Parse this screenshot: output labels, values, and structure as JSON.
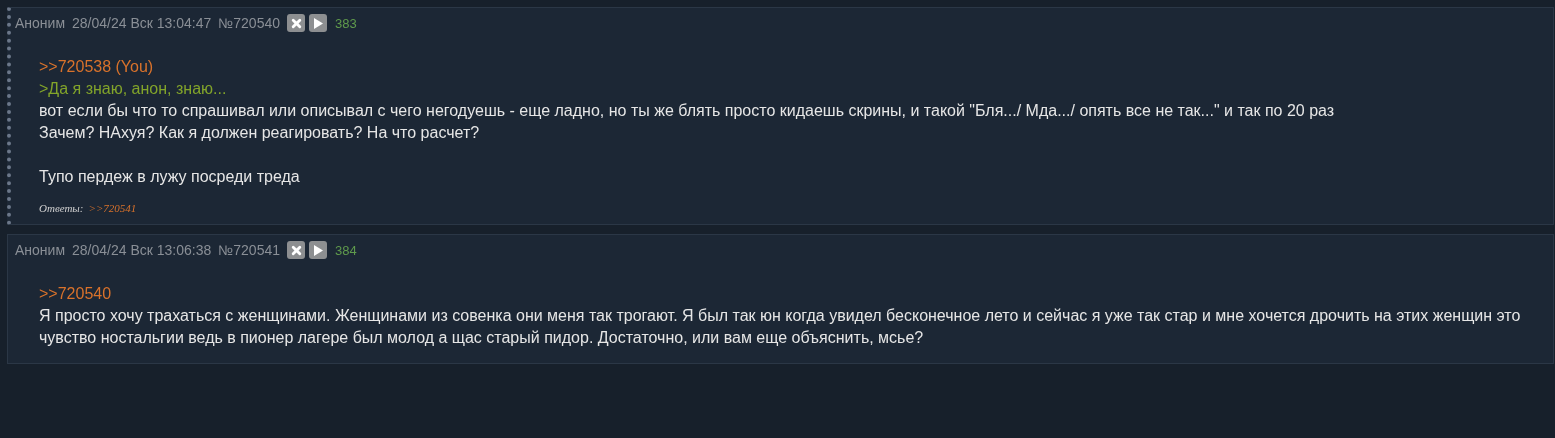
{
  "posts": [
    {
      "highlighted": true,
      "name": "Аноним",
      "date": "28/04/24 Вск 13:04:47",
      "number": "№720540",
      "count": "383",
      "lines": [
        {
          "kind": "reply_link",
          "text": ">>720538 (You)"
        },
        {
          "kind": "quote",
          "text": ">Да я знаю, анон, знаю..."
        },
        {
          "kind": "text",
          "text": "вот если бы что то спрашивал или описывал с чего негодуешь - еще ладно, но ты же блять просто кидаешь скрины, и такой \"Бля.../ Мда.../ опять все не так...\" и так по 20 раз"
        },
        {
          "kind": "text",
          "text": "Зачем? НАхуя? Как я должен реагировать? На что расчет?"
        },
        {
          "kind": "blank"
        },
        {
          "kind": "text",
          "text": "Тупо пердеж в лужу посреди треда"
        }
      ],
      "replies": {
        "label": "Ответы:",
        "links": [
          ">>720541"
        ]
      }
    },
    {
      "highlighted": false,
      "name": "Аноним",
      "date": "28/04/24 Вск 13:06:38",
      "number": "№720541",
      "count": "384",
      "lines": [
        {
          "kind": "reply_link",
          "text": ">>720540"
        },
        {
          "kind": "text",
          "text": "Я просто хочу трахаться с женщинами. Женщинами из совенка они меня так трогают. Я был так юн когда увидел бесконечное лето и сейчас я уже так стар и мне хочется дрочить на этих женщин это чувство ностальгии ведь в пионер лагере был молод а щас старый пидор. Достаточно, или вам еще объяснить, мсье?"
        }
      ]
    }
  ]
}
